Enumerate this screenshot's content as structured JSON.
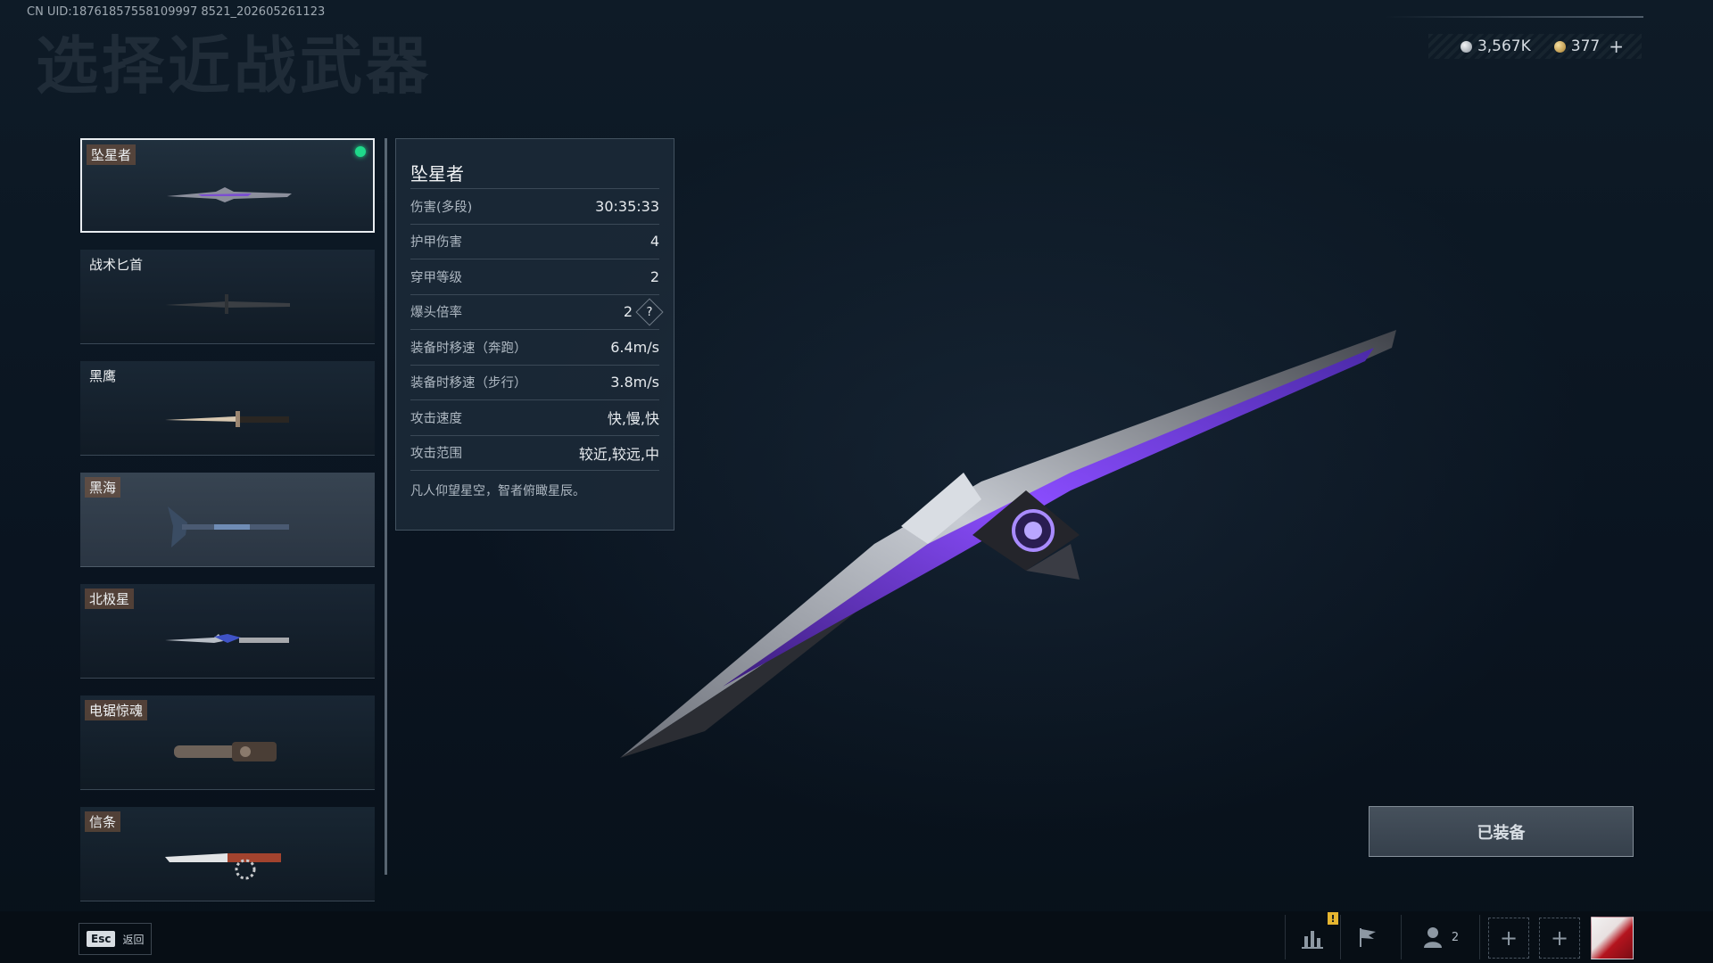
{
  "uid_text": "CN UID:18761857558109997 8521_202605261123",
  "page_title": "选择近战武器",
  "currency": {
    "silver": "3,567K",
    "gold": "377",
    "add": "+"
  },
  "weapons": [
    {
      "name": "坠星者",
      "equipped": true
    },
    {
      "name": "战术匕首"
    },
    {
      "name": "黑鹰"
    },
    {
      "name": "黑海"
    },
    {
      "name": "北极星"
    },
    {
      "name": "电锯惊魂"
    },
    {
      "name": "信条"
    }
  ],
  "stats": {
    "title": "坠星者",
    "rows": [
      {
        "label": "伤害(多段)",
        "value": "30:35:33"
      },
      {
        "label": "护甲伤害",
        "value": "4"
      },
      {
        "label": "穿甲等级",
        "value": "2"
      },
      {
        "label": "爆头倍率",
        "value": "2",
        "help": "?"
      },
      {
        "label": "装备时移速（奔跑）",
        "value": "6.4m/s"
      },
      {
        "label": "装备时移速（步行）",
        "value": "3.8m/s"
      },
      {
        "label": "攻击速度",
        "value": "快,慢,快"
      },
      {
        "label": "攻击范围",
        "value": "较近,较远,中"
      }
    ],
    "description": "凡人仰望星空，智者俯瞰星辰。"
  },
  "equip_button": "已装备",
  "bottom": {
    "esc_key": "Esc",
    "esc_label": "返回",
    "friends_count": "2",
    "alert": "!",
    "slot": "+"
  }
}
